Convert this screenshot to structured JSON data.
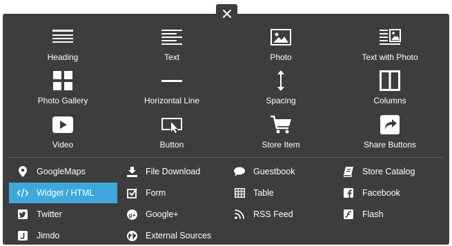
{
  "close_label": "✕",
  "tiles": [
    {
      "label": "Heading",
      "icon": "heading-icon"
    },
    {
      "label": "Text",
      "icon": "text-icon"
    },
    {
      "label": "Photo",
      "icon": "photo-icon"
    },
    {
      "label": "Text with Photo",
      "icon": "text-with-photo-icon"
    },
    {
      "label": "Photo Gallery",
      "icon": "photo-gallery-icon"
    },
    {
      "label": "Horizontal Line",
      "icon": "horizontal-line-icon"
    },
    {
      "label": "Spacing",
      "icon": "spacing-icon"
    },
    {
      "label": "Columns",
      "icon": "columns-icon"
    },
    {
      "label": "Video",
      "icon": "video-icon"
    },
    {
      "label": "Button",
      "icon": "button-icon"
    },
    {
      "label": "Store Item",
      "icon": "cart-icon"
    },
    {
      "label": "Share Buttons",
      "icon": "share-icon"
    }
  ],
  "list": [
    {
      "label": "GoogleMaps",
      "icon": "map-pin-icon"
    },
    {
      "label": "File Download",
      "icon": "download-icon"
    },
    {
      "label": "Guestbook",
      "icon": "speech-bubble-icon"
    },
    {
      "label": "Store Catalog",
      "icon": "book-icon"
    },
    {
      "label": "Widget / HTML",
      "icon": "code-icon",
      "active": true
    },
    {
      "label": "Form",
      "icon": "checkbox-icon"
    },
    {
      "label": "Table",
      "icon": "table-icon"
    },
    {
      "label": "Facebook",
      "icon": "facebook-icon"
    },
    {
      "label": "Twitter",
      "icon": "twitter-icon"
    },
    {
      "label": "Google+",
      "icon": "google-plus-icon"
    },
    {
      "label": "RSS Feed",
      "icon": "rss-icon"
    },
    {
      "label": "Flash",
      "icon": "flash-icon"
    },
    {
      "label": "Jimdo",
      "icon": "jimdo-icon"
    },
    {
      "label": "External Sources",
      "icon": "globe-icon"
    }
  ],
  "colors": {
    "panel": "#3d3d3d",
    "active": "#3ea8dd",
    "text": "#ffffff"
  }
}
